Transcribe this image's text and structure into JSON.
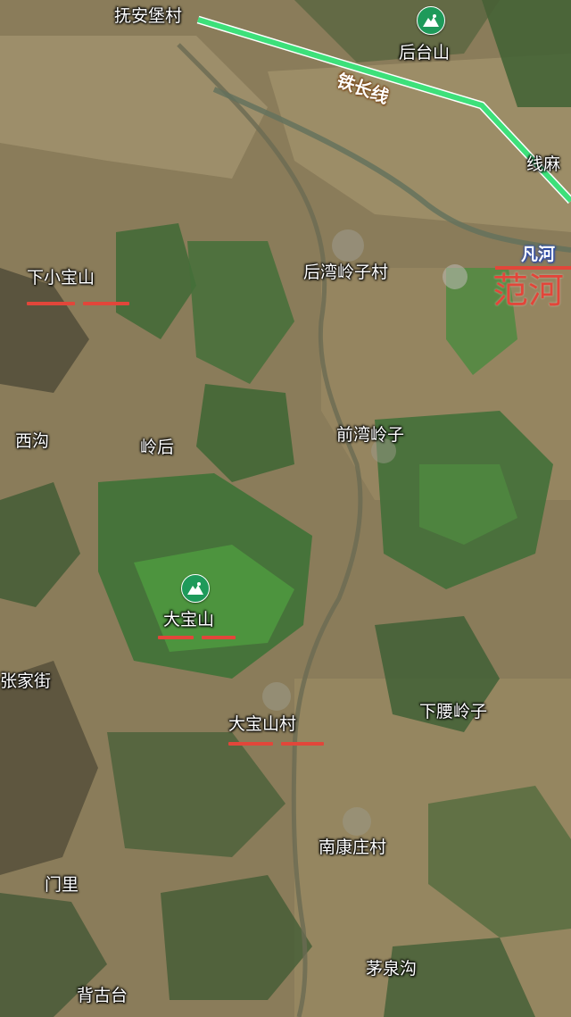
{
  "map": {
    "places": {
      "fuanbao": "抚安堡村",
      "houtaishan": "后台山",
      "xianma": "线麻",
      "houwanlingzi": "后湾岭子村",
      "xiaxiaobaoshan": "下小宝山",
      "xigou": "西沟",
      "linghou": "岭后",
      "qianwanlingzi": "前湾岭子",
      "dabaoshan": "大宝山",
      "zhangjiajie": "张家街",
      "xiayaolingzi": "下腰岭子",
      "dabaoshancun": "大宝山村",
      "nankangzhuang": "南康庄村",
      "menli": "门里",
      "maoquangou": "茅泉沟",
      "beigutai": "背古台"
    },
    "road_label": "铁长线",
    "river_label": "凡河",
    "river_overlay": "范河",
    "colors": {
      "highlight_underline": "#e2463a",
      "river_overlay_text": "#e2463a",
      "mountain_pin": "#1e9a5a",
      "railway_line": "#3de07a",
      "river_label_outline": "#1b3fb0"
    },
    "icons": {
      "mountain_pin": "mountain-icon"
    }
  }
}
